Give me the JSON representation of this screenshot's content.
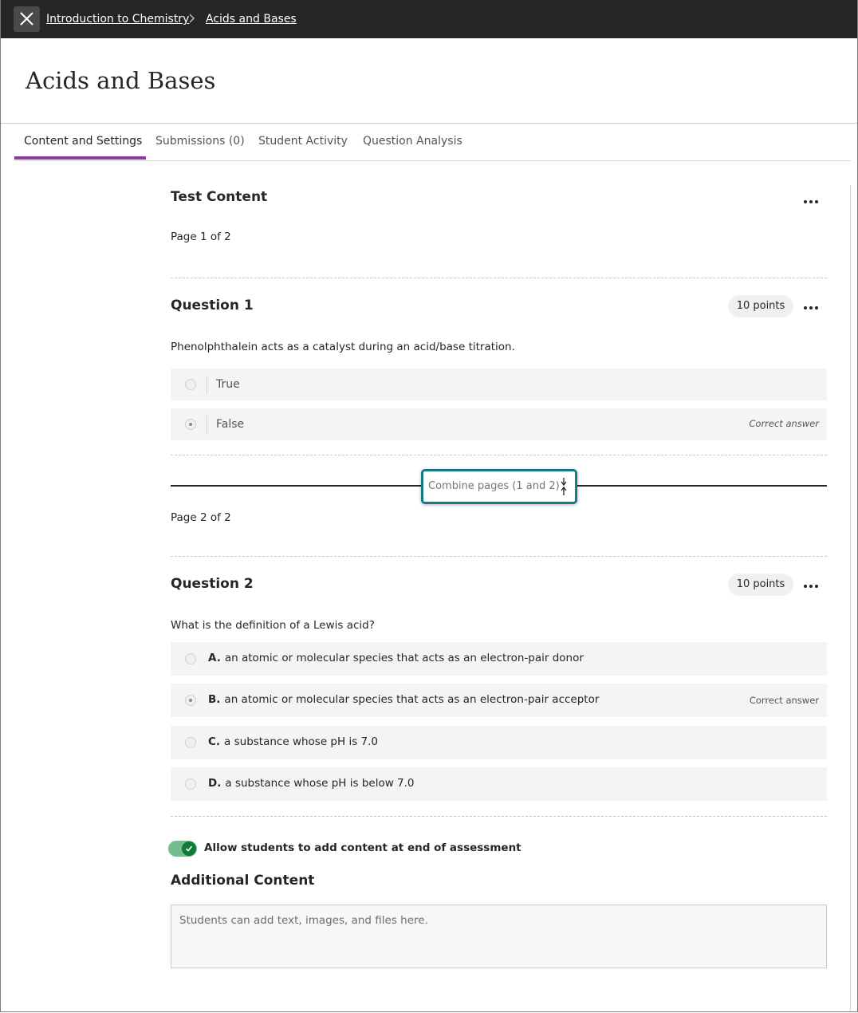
{
  "breadcrumb": {
    "items": [
      "Introduction to Chemistry",
      "Acids and Bases"
    ]
  },
  "page": {
    "title": "Acids and Bases"
  },
  "tabs": [
    {
      "label": "Content and Settings",
      "active": true
    },
    {
      "label": "Submissions (0)",
      "active": false
    },
    {
      "label": "Student Activity",
      "active": false
    },
    {
      "label": "Question Analysis",
      "active": false
    }
  ],
  "test_content": {
    "heading": "Test Content",
    "page1_label": "Page 1 of 2",
    "page2_label": "Page 2 of 2",
    "combine_label": "Combine pages (1 and 2)"
  },
  "questions": [
    {
      "title": "Question 1",
      "points": "10 points",
      "prompt": "Phenolphthalein acts as a catalyst during an acid/base titration.",
      "answers": [
        {
          "text": "True",
          "selected": false
        },
        {
          "text": "False",
          "selected": true,
          "note": "Correct answer"
        }
      ]
    },
    {
      "title": "Question 2",
      "points": "10 points",
      "prompt": "What is the definition of a Lewis acid?",
      "answers": [
        {
          "letter": "A.",
          "text": "an atomic or molecular species that acts as an electron-pair donor",
          "selected": false
        },
        {
          "letter": "B.",
          "text": "an atomic or molecular species that acts as an electron-pair acceptor",
          "selected": true,
          "note": "Correct answer"
        },
        {
          "letter": "C.",
          "text": "a substance whose pH is 7.0",
          "selected": false
        },
        {
          "letter": "D.",
          "text": "a substance whose pH is below 7.0",
          "selected": false
        }
      ]
    }
  ],
  "additional": {
    "toggle_label": "Allow students to add content at end of assessment",
    "toggle_on": true,
    "heading": "Additional Content",
    "placeholder": "Students can add text, images, and files here."
  },
  "colors": {
    "topbar": "#262626",
    "tab_accent": "#8e3aa0",
    "combine_border": "#137b84",
    "toggle_on": "#107a38"
  },
  "icons": [
    "close-icon",
    "chevron-right-icon",
    "more-icon",
    "combine-arrows-icon",
    "check-icon"
  ]
}
